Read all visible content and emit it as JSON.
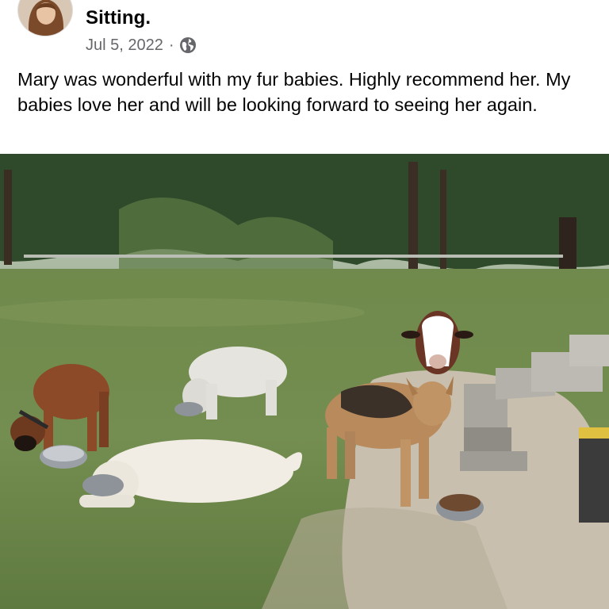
{
  "post": {
    "title_fragment": "Sitting.",
    "date": "Jul 5, 2022",
    "separator": "·",
    "audience_icon": "globe-icon",
    "body": "Mary was wonderful with my fur babies. Highly recommend her. My babies love her and will be looking forward to seeing her again."
  },
  "photo": {
    "subject": "five dogs eating from bowls in a grassy backyard beside wooden steps",
    "icon": "photo"
  },
  "colors": {
    "meta_gray": "#65676b",
    "text_black": "#050505"
  }
}
